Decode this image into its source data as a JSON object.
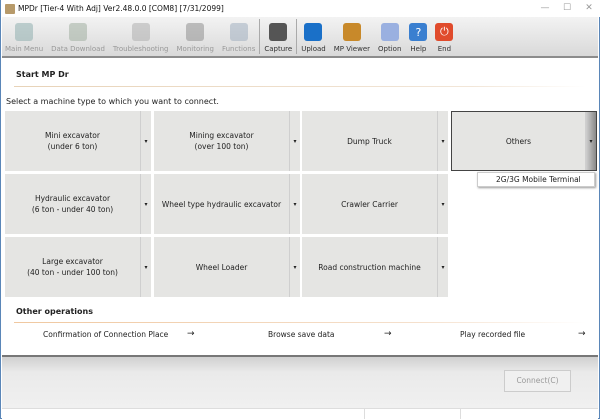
{
  "window": {
    "title": "MPDr [Tier-4 With Adj] Ver2.48.0.0 [COM8] [7/31/2099]"
  },
  "toolbar": [
    {
      "label": "Main Menu",
      "icon": "main-menu-icon",
      "enabled": false
    },
    {
      "label": "Data Download",
      "icon": "data-download-icon",
      "enabled": false
    },
    {
      "label": "Troubleshooting",
      "icon": "stethoscope-icon",
      "enabled": false
    },
    {
      "label": "Monitoring",
      "icon": "gauge-icon",
      "enabled": false
    },
    {
      "label": "Functions",
      "icon": "functions-icon",
      "enabled": false
    },
    {
      "label": "Capture",
      "icon": "camera-icon",
      "enabled": true
    },
    {
      "label": "Upload",
      "icon": "upload-icon",
      "enabled": true
    },
    {
      "label": "MP Viewer",
      "icon": "mp-viewer-icon",
      "enabled": true
    },
    {
      "label": "Option",
      "icon": "gear-icon",
      "enabled": true
    },
    {
      "label": "Help",
      "icon": "help-icon",
      "enabled": true,
      "glyph": "?"
    },
    {
      "label": "End",
      "icon": "power-icon",
      "enabled": true,
      "glyph": "⏻"
    }
  ],
  "start": {
    "heading": "Start MP Dr",
    "instruction": "Select a machine type to which you want to connect."
  },
  "machines": [
    {
      "l1": "Mini excavator",
      "l2": "(under 6 ton)"
    },
    {
      "l1": "Mining excavator",
      "l2": "(over 100 ton)"
    },
    {
      "l1": "Dump Truck",
      "l2": ""
    },
    {
      "l1": "Others",
      "l2": ""
    },
    {
      "l1": "Hydraulic excavator",
      "l2": "(6 ton - under 40 ton)"
    },
    {
      "l1": "Wheel type hydraulic excavator",
      "l2": ""
    },
    {
      "l1": "Crawler Carrier",
      "l2": ""
    },
    {
      "l1": "Large excavator",
      "l2": "(40 ton - under 100 ton)"
    },
    {
      "l1": "Wheel Loader",
      "l2": ""
    },
    {
      "l1": "Road construction machine",
      "l2": ""
    }
  ],
  "dropdown": {
    "item": "2G/3G Mobile Terminal"
  },
  "other": {
    "heading": "Other operations",
    "links": [
      "Confirmation of Connection Place",
      "Browse save data",
      "Play recorded file"
    ],
    "arrow": "→"
  },
  "footer": {
    "connect": "Connect(C)"
  },
  "arrow_glyph": "▾",
  "colors": {
    "help": "#3a7fd0",
    "end": "#e04b2c"
  }
}
